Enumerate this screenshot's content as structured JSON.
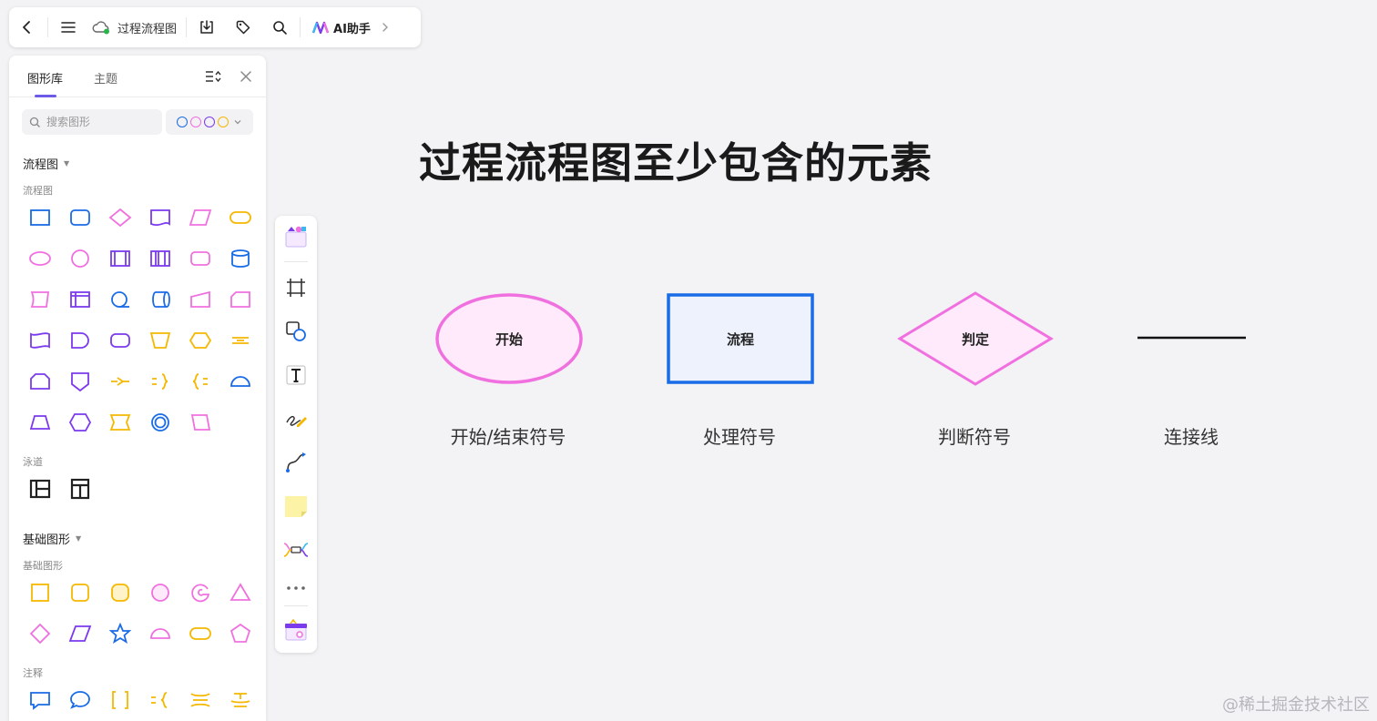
{
  "toolbar": {
    "doc_title": "过程流程图",
    "ai_label": "AI助手"
  },
  "panel": {
    "tabs": [
      "图形库",
      "主题"
    ],
    "search_placeholder": "搜索图形",
    "sections": {
      "flowchart_title": "流程图",
      "flowchart_sub": "流程图",
      "swimlane_sub": "泳道",
      "basic_title": "基础图形",
      "basic_sub": "基础图形",
      "annotation_sub": "注释"
    },
    "palette_colors": [
      "#1a6be6",
      "#f070e0",
      "#7c3aed",
      "#f5b800"
    ]
  },
  "canvas": {
    "title": "过程流程图至少包含的元素",
    "shapes": [
      {
        "label": "开始",
        "caption": "开始/结束符号"
      },
      {
        "label": "流程",
        "caption": "处理符号"
      },
      {
        "label": "判定",
        "caption": "判断符号"
      },
      {
        "label": "",
        "caption": "连接线"
      }
    ]
  },
  "colors": {
    "blue": "#1a6be6",
    "pink": "#f070e0",
    "purple": "#7c3aed",
    "yellow": "#f5b800",
    "accent": "#6b5be6"
  },
  "watermark": "@稀土掘金技术社区"
}
